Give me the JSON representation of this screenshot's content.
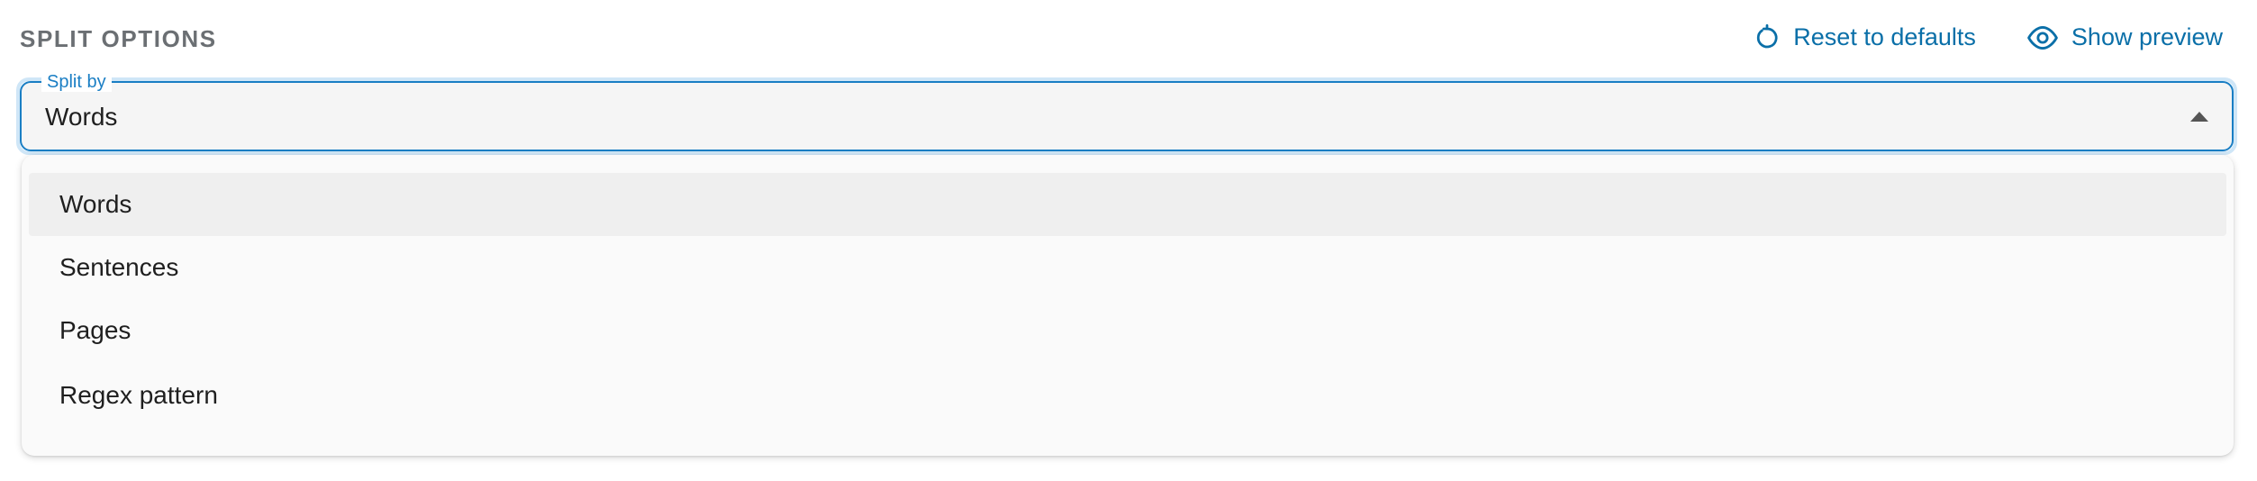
{
  "section": {
    "title": "SPLIT OPTIONS"
  },
  "actions": {
    "reset_label": "Reset to defaults",
    "preview_label": "Show preview"
  },
  "select": {
    "label": "Split by",
    "value": "Words",
    "options": [
      "Words",
      "Sentences",
      "Pages",
      "Regex pattern"
    ],
    "selected_index": 0
  },
  "colors": {
    "accent": "#0a6fa8",
    "focus_border": "#1a7ec4",
    "title": "#6b6f73"
  }
}
